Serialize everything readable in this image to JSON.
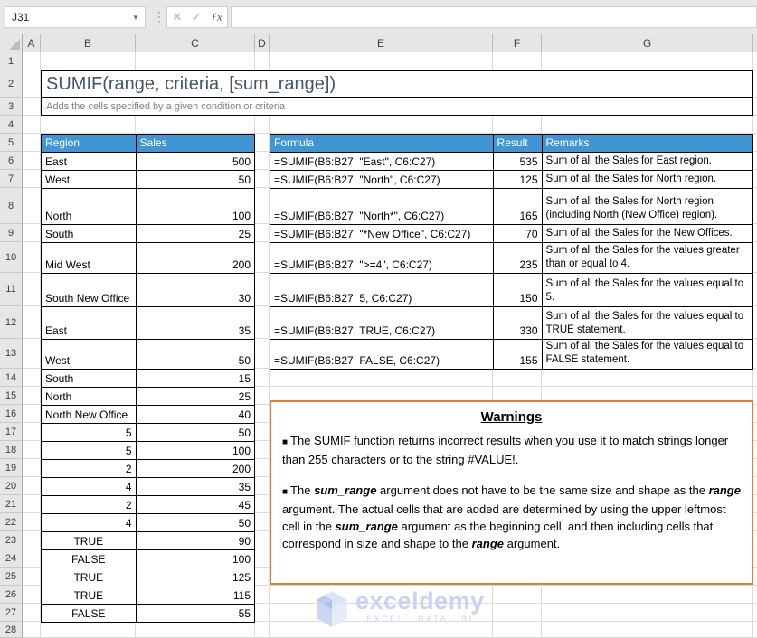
{
  "colors": {
    "header_blue": "#3F96D3",
    "warning_border": "#E87D31",
    "title_color": "#44546A",
    "watermark": "#C8D3F2"
  },
  "toolbar": {
    "name_box_value": "J31",
    "dropdown_glyph": "▼",
    "more_glyph": "⋮",
    "cancel_glyph": "✕",
    "confirm_glyph": "✓",
    "fx_glyph": "ƒx",
    "formula_bar_value": ""
  },
  "sheet": {
    "col_headers": [
      "A",
      "B",
      "C",
      "D",
      "E",
      "F",
      "G"
    ],
    "row_count": 28
  },
  "title_block": {
    "title": "SUMIF(range, criteria, [sum_range])",
    "subtitle": "Adds the cells specified by a given condition or criteria"
  },
  "sales_table": {
    "headers": [
      "Region",
      "Sales"
    ],
    "rows": [
      {
        "region": "East",
        "sales": "500",
        "align": "left"
      },
      {
        "region": "West",
        "sales": "50",
        "align": "left"
      },
      {
        "region": "North",
        "sales": "100",
        "align": "left"
      },
      {
        "region": "South",
        "sales": "25",
        "align": "left"
      },
      {
        "region": "Mid West",
        "sales": "200",
        "align": "left"
      },
      {
        "region": "South New Office",
        "sales": "30",
        "align": "left"
      },
      {
        "region": "East",
        "sales": "35",
        "align": "left"
      },
      {
        "region": "West",
        "sales": "50",
        "align": "left"
      },
      {
        "region": "South",
        "sales": "15",
        "align": "left"
      },
      {
        "region": "North",
        "sales": "25",
        "align": "left"
      },
      {
        "region": "North New Office",
        "sales": "40",
        "align": "left"
      },
      {
        "region": "5",
        "sales": "50",
        "align": "right"
      },
      {
        "region": "5",
        "sales": "100",
        "align": "right"
      },
      {
        "region": "2",
        "sales": "200",
        "align": "right"
      },
      {
        "region": "4",
        "sales": "35",
        "align": "right"
      },
      {
        "region": "2",
        "sales": "45",
        "align": "right"
      },
      {
        "region": "4",
        "sales": "50",
        "align": "right"
      },
      {
        "region": "TRUE",
        "sales": "90",
        "align": "center"
      },
      {
        "region": "FALSE",
        "sales": "100",
        "align": "center"
      },
      {
        "region": "TRUE",
        "sales": "125",
        "align": "center"
      },
      {
        "region": "TRUE",
        "sales": "115",
        "align": "center"
      },
      {
        "region": "FALSE",
        "sales": "55",
        "align": "center"
      }
    ]
  },
  "formula_table": {
    "headers": [
      "Formula",
      "Result",
      "Remarks"
    ],
    "rows": [
      {
        "formula": "=SUMIF(B6:B27, \"East\", C6:C27)",
        "result": "535",
        "remarks": "Sum of all the Sales for East region."
      },
      {
        "formula": "=SUMIF(B6:B27, \"North\", C6:C27)",
        "result": "125",
        "remarks": "Sum of all the Sales for North region."
      },
      {
        "formula": "=SUMIF(B6:B27, \"North*\", C6:C27)",
        "result": "165",
        "remarks": "Sum of all the Sales for North region (including North (New Office) region)."
      },
      {
        "formula": "=SUMIF(B6:B27, \"*New Office\", C6:C27)",
        "result": "70",
        "remarks": "Sum of all the Sales for the New Offices."
      },
      {
        "formula": "=SUMIF(B6:B27, \">=4\", C6:C27)",
        "result": "235",
        "remarks": "Sum of all the Sales for the values greater than or equal to 4."
      },
      {
        "formula": "=SUMIF(B6:B27, 5, C6:C27)",
        "result": "150",
        "remarks": "Sum of all the Sales for the values equal to 5."
      },
      {
        "formula": "=SUMIF(B6:B27, TRUE, C6:C27)",
        "result": "330",
        "remarks": "Sum of all the Sales for the values equal to TRUE statement."
      },
      {
        "formula": "=SUMIF(B6:B27, FALSE, C6:C27)",
        "result": "155",
        "remarks": "Sum of all the Sales for the values equal to FALSE statement."
      }
    ]
  },
  "warnings": {
    "title": "Warnings",
    "bullet_glyph": "■",
    "bullets": [
      [
        {
          "t": "The SUMIF function returns incorrect results when you use it to match strings longer than 255 characters or to the string #VALUE!."
        }
      ],
      [
        {
          "t": "The "
        },
        {
          "t": "sum_range",
          "em": true
        },
        {
          "t": " argument does not have to be the same size and shape as the "
        },
        {
          "t": "range",
          "em": true
        },
        {
          "t": " argument. The actual cells that are added are determined by using the upper leftmost cell in the "
        },
        {
          "t": "sum_range",
          "em": true
        },
        {
          "t": " argument as the beginning cell, and then including cells that correspond in size and shape to the "
        },
        {
          "t": "range",
          "em": true
        },
        {
          "t": " argument."
        }
      ]
    ]
  },
  "watermark": {
    "brand": "exceldemy",
    "tagline": "EXCEL · DATA · BI"
  }
}
